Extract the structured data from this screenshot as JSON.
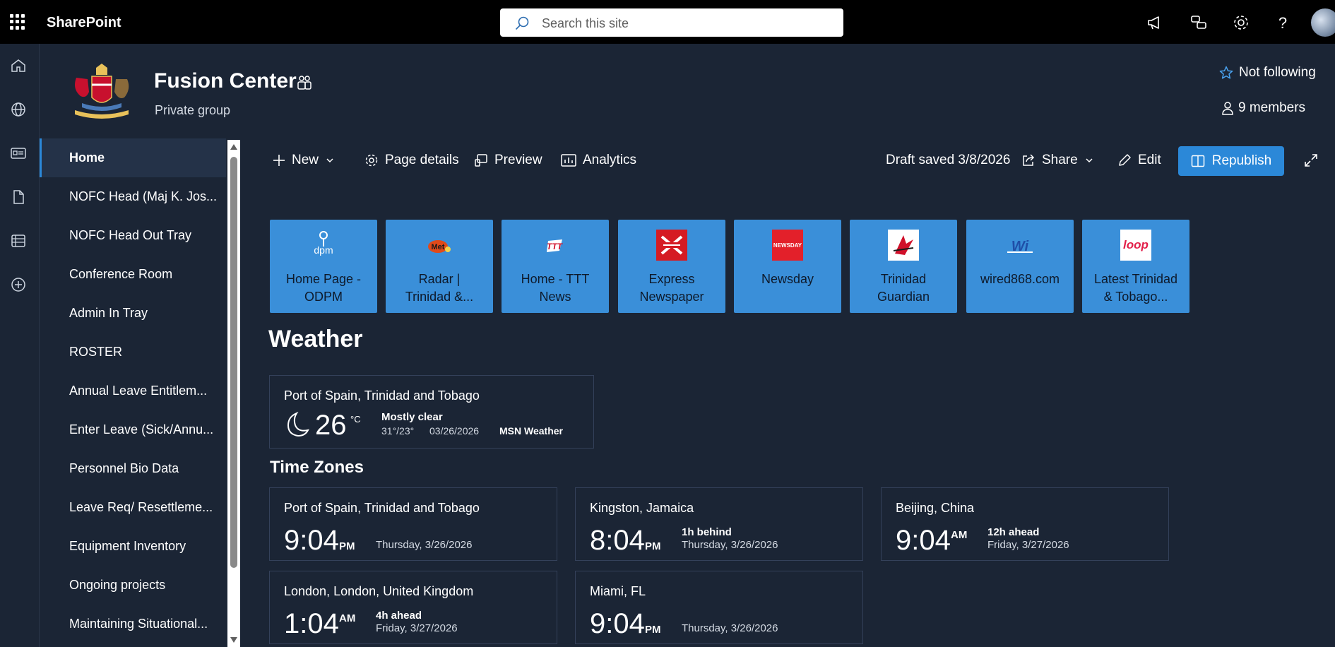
{
  "suitebar": {
    "app_name": "SharePoint",
    "search_placeholder": "Search this site"
  },
  "site": {
    "title": "Fusion Center",
    "subtitle": "Private group",
    "follow_label": "Not following",
    "members_label": "9 members"
  },
  "nav": {
    "items": [
      "Home",
      "NOFC Head (Maj K. Jos...",
      "NOFC Head Out Tray",
      "Conference Room",
      "Admin In Tray",
      "ROSTER",
      "Annual Leave Entitlem...",
      "Enter Leave (Sick/Annu...",
      "Personnel Bio Data",
      "Leave Req/ Resettleme...",
      "Equipment Inventory",
      "Ongoing projects",
      "Maintaining Situational..."
    ]
  },
  "commandbar": {
    "new_label": "New",
    "page_details_label": "Page details",
    "preview_label": "Preview",
    "analytics_label": "Analytics",
    "draft_status": "Draft saved 3/8/2026",
    "share_label": "Share",
    "edit_label": "Edit",
    "republish_label": "Republish"
  },
  "quick_links": [
    {
      "line1": "Home Page -",
      "line2": "ODPM",
      "icon": "odpm-logo"
    },
    {
      "line1": "Radar |",
      "line2": "Trinidad &...",
      "icon": "met-logo"
    },
    {
      "line1": "Home - TTT",
      "line2": "News",
      "icon": "ttt-logo"
    },
    {
      "line1": "Express",
      "line2": "Newspaper",
      "icon": "express-logo"
    },
    {
      "line1": "Newsday",
      "line2": "",
      "icon": "newsday-logo",
      "icon_text": "NEWSDAY"
    },
    {
      "line1": "Trinidad",
      "line2": "Guardian",
      "icon": "guardian-logo"
    },
    {
      "line1": "wired868.com",
      "line2": "",
      "icon": "wired868-logo"
    },
    {
      "line1": "Latest Trinidad",
      "line2": "& Tobago...",
      "icon": "loop-logo",
      "icon_text": "loop"
    }
  ],
  "weather": {
    "section_title": "Weather",
    "location": "Port of Spain, Trinidad and Tobago",
    "temperature": "26",
    "unit": "°C",
    "condition": "Mostly clear",
    "hi_lo": "31°/23°",
    "date": "03/26/2026",
    "source": "MSN Weather"
  },
  "timezones": {
    "section_title": "Time Zones",
    "clocks": [
      {
        "location": "Port of Spain, Trinidad and Tobago",
        "time": "9:04",
        "ampm": "PM",
        "relative": "",
        "day": "Thursday, 3/26/2026"
      },
      {
        "location": "Kingston, Jamaica",
        "time": "8:04",
        "ampm": "PM",
        "relative": "1h behind",
        "day": "Thursday, 3/26/2026"
      },
      {
        "location": "Beijing, China",
        "time": "9:04",
        "ampm": "AM",
        "relative": "12h ahead",
        "day": "Friday, 3/27/2026"
      },
      {
        "location": "London, London, United Kingdom",
        "time": "1:04",
        "ampm": "AM",
        "relative": "4h ahead",
        "day": "Friday, 3/27/2026"
      },
      {
        "location": "Miami, FL",
        "time": "9:04",
        "ampm": "PM",
        "relative": "",
        "day": "Thursday, 3/26/2026"
      }
    ]
  },
  "colors": {
    "background": "#1b2535",
    "accent": "#2b88d8",
    "tile": "#3a8fd9"
  }
}
